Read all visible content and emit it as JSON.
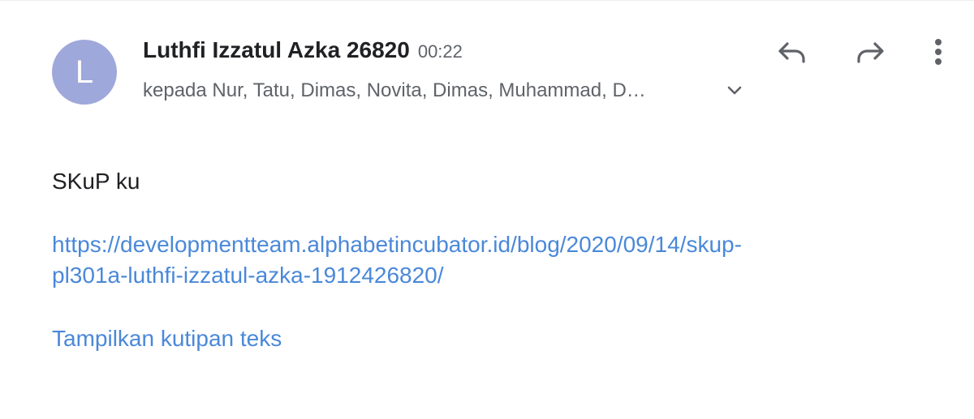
{
  "email": {
    "avatar_letter": "L",
    "avatar_color": "#9fa8da",
    "sender_name": "Luthfi Izzatul Azka 26820",
    "time": "00:22",
    "recipients": "kepada Nur, Tatu, Dimas, Novita, Dimas, Muhammad, D…",
    "body": "SKuP ku",
    "link_line1": "https://developmentteam.alphabetincubator.id/blog/2020/09/14/skup-",
    "link_line2": "pl301a-luthfi-izzatul-azka-1912426820/",
    "show_quoted_label": "Tampilkan kutipan teks",
    "link_color": "#4a88d9"
  },
  "actions": {
    "reply_icon": "reply-icon",
    "forward_icon": "forward-icon",
    "more_icon": "more-vert-icon",
    "expand_icon": "chevron-down-icon"
  }
}
